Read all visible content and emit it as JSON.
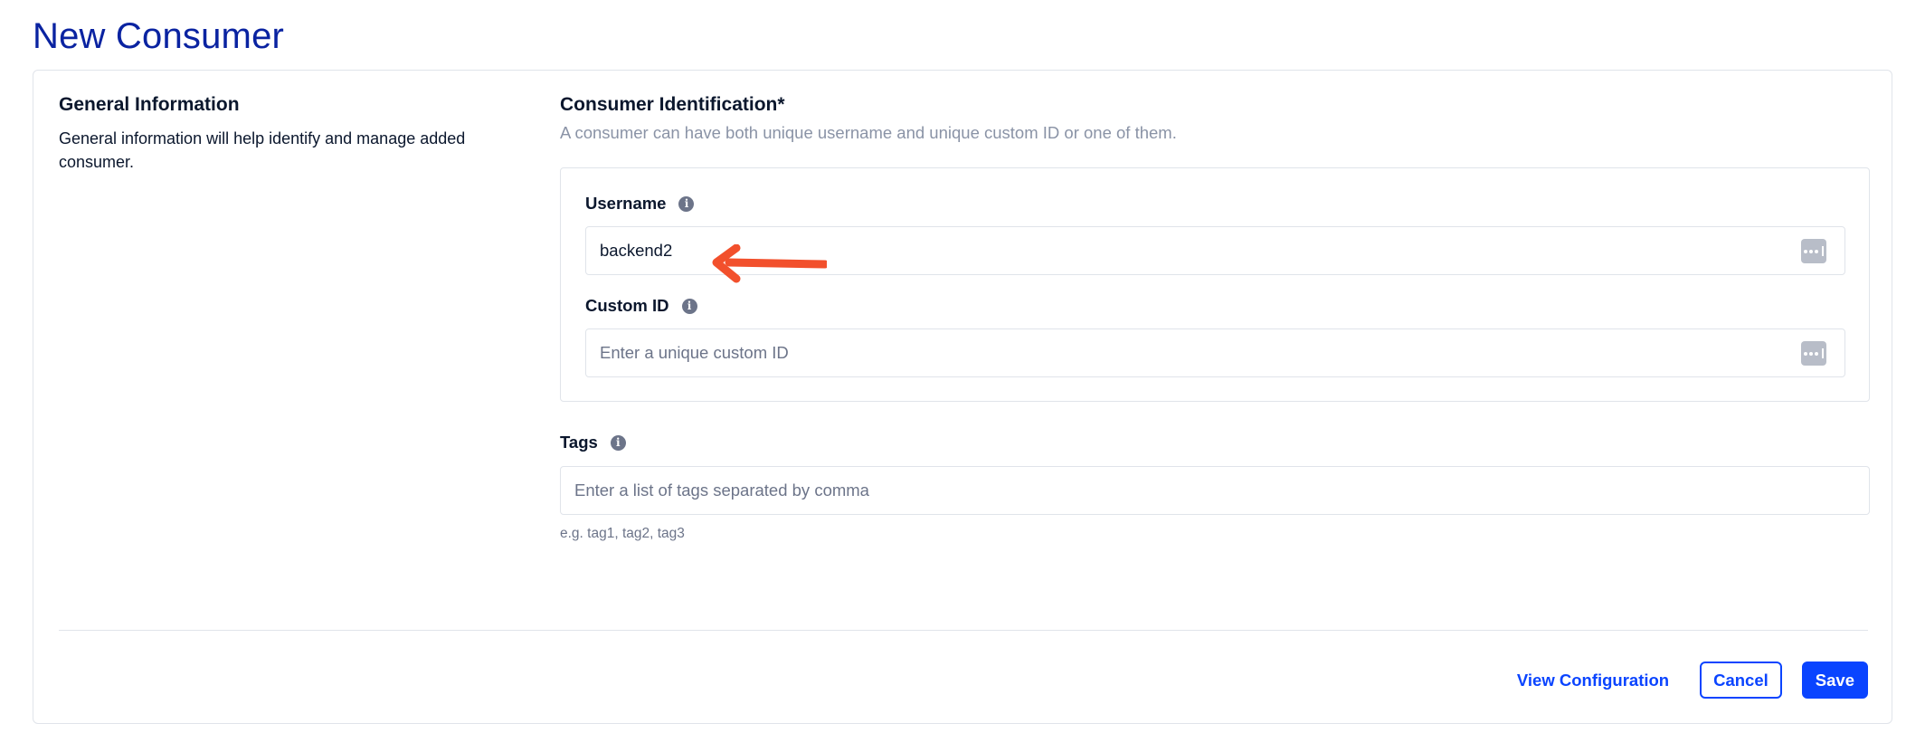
{
  "page": {
    "title": "New Consumer"
  },
  "general": {
    "title": "General Information",
    "description": "General information will help identify and manage added consumer."
  },
  "identification": {
    "title": "Consumer Identification*",
    "description": "A consumer can have both unique username and unique custom ID or one of them.",
    "username": {
      "label": "Username",
      "value": "backend2",
      "icon": "info-icon",
      "action_icon": "password-generator-icon"
    },
    "custom_id": {
      "label": "Custom ID",
      "placeholder": "Enter a unique custom ID",
      "icon": "info-icon",
      "action_icon": "password-generator-icon"
    }
  },
  "tags": {
    "label": "Tags",
    "placeholder": "Enter a list of tags separated by comma",
    "help": "e.g. tag1, tag2, tag3",
    "icon": "info-icon"
  },
  "footer": {
    "view_config_label": "View Configuration",
    "cancel_label": "Cancel",
    "save_label": "Save"
  },
  "colors": {
    "title": "#0a23a1",
    "accent": "#0a44ff",
    "annotation_arrow": "#f2502c",
    "muted": "#8a93a6"
  },
  "annotation": {
    "icon": "red-arrow-annotation"
  }
}
